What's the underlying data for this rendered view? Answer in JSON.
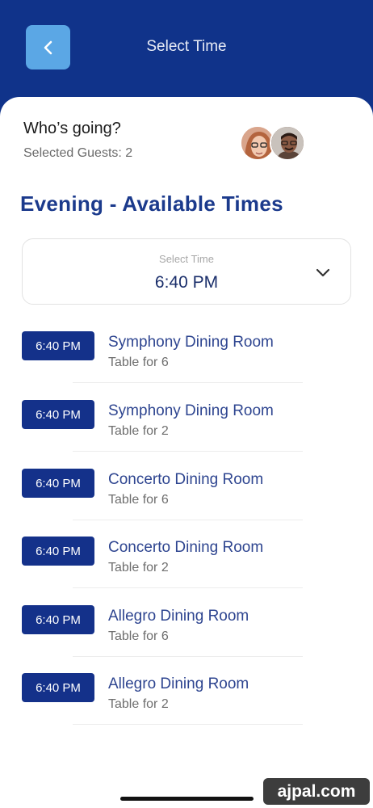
{
  "header": {
    "title": "Select Time",
    "back_icon": "chevron-left-icon"
  },
  "guests": {
    "title": "Who’s going?",
    "subtitle": "Selected Guests: 2"
  },
  "section_title": "Evening - Available Times",
  "time_select": {
    "label": "Select Time",
    "value": "6:40 PM",
    "icon": "chevron-down-icon"
  },
  "options": [
    {
      "time": "6:40 PM",
      "room": "Symphony Dining Room",
      "table": "Table for 6"
    },
    {
      "time": "6:40 PM",
      "room": "Symphony Dining Room",
      "table": "Table for 2"
    },
    {
      "time": "6:40 PM",
      "room": "Concerto Dining Room",
      "table": "Table for 6"
    },
    {
      "time": "6:40 PM",
      "room": "Concerto Dining Room",
      "table": "Table for 2"
    },
    {
      "time": "6:40 PM",
      "room": "Allegro Dining Room",
      "table": "Table for 6"
    },
    {
      "time": "6:40 PM",
      "room": "Allegro Dining Room",
      "table": "Table for 2"
    }
  ],
  "watermark": "ajpal.com",
  "colors": {
    "brand_navy": "#10338a",
    "back_button": "#5ba7e5",
    "badge": "#14318a",
    "room_text": "#2e4590"
  }
}
